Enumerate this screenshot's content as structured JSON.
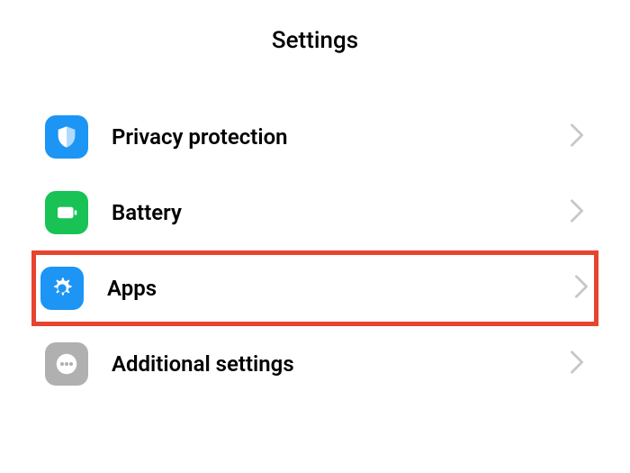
{
  "header": {
    "title": "Settings"
  },
  "items": [
    {
      "label": "Privacy protection",
      "icon": "shield-icon",
      "iconColor": "#1c95f5",
      "highlighted": false
    },
    {
      "label": "Battery",
      "icon": "battery-icon",
      "iconColor": "#18c255",
      "highlighted": false
    },
    {
      "label": "Apps",
      "icon": "gear-icon",
      "iconColor": "#1c95f5",
      "highlighted": true
    },
    {
      "label": "Additional settings",
      "icon": "ellipsis-icon",
      "iconColor": "#b0b0b0",
      "highlighted": false
    }
  ],
  "annotations": {
    "highlightColor": "#e8432f"
  }
}
